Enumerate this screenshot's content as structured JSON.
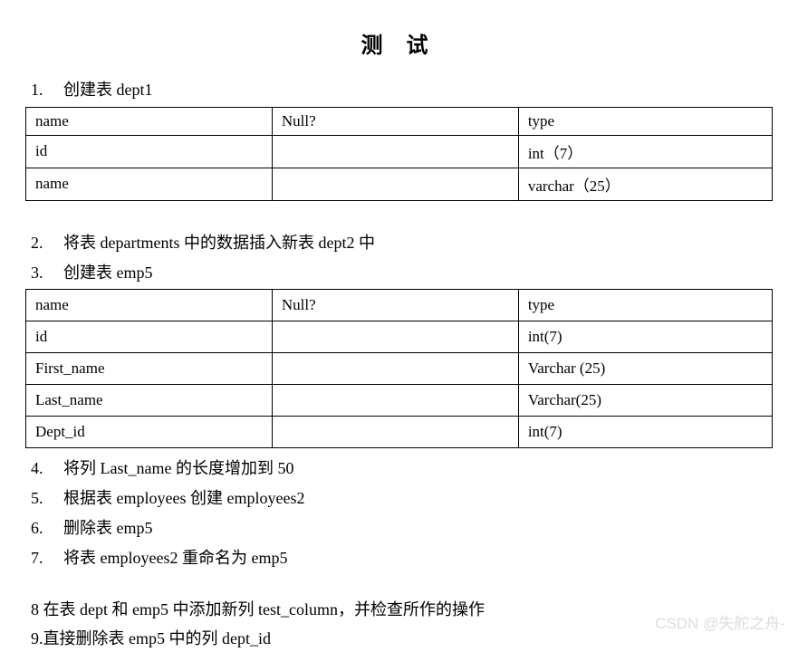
{
  "title": "测 试",
  "items": {
    "i1_num": "1.",
    "i1_text": "创建表 dept1",
    "i2_num": "2.",
    "i2_text": "将表 departments 中的数据插入新表 dept2 中",
    "i3_num": "3.",
    "i3_text": "创建表 emp5",
    "i4_num": "4.",
    "i4_text": "将列 Last_name 的长度增加到 50",
    "i5_num": "5.",
    "i5_text": "根据表 employees 创建 employees2",
    "i6_num": "6.",
    "i6_text": "删除表 emp5",
    "i7_num": "7.",
    "i7_text": "将表 employees2 重命名为 emp5",
    "i8_text": "8 在表 dept 和 emp5 中添加新列 test_column，并检查所作的操作",
    "i9_text": "9.直接删除表 emp5 中的列  dept_id"
  },
  "table1": {
    "h1": "name",
    "h2": "Null?",
    "h3": "type",
    "r1c1": "id",
    "r1c2": "",
    "r1c3": "int（7）",
    "r2c1": "name",
    "r2c2": "",
    "r2c3": "varchar（25）"
  },
  "table2": {
    "h1": "name",
    "h2": "Null?",
    "h3": "type",
    "r1c1": "id",
    "r1c2": "",
    "r1c3": "int(7)",
    "r2c1": "First_name",
    "r2c2": "",
    "r2c3": "Varchar (25)",
    "r3c1": "Last_name",
    "r3c2": "",
    "r3c3": "Varchar(25)",
    "r4c1": "Dept_id",
    "r4c2": "",
    "r4c3": "int(7)"
  },
  "watermark": "CSDN @失舵之舟-"
}
